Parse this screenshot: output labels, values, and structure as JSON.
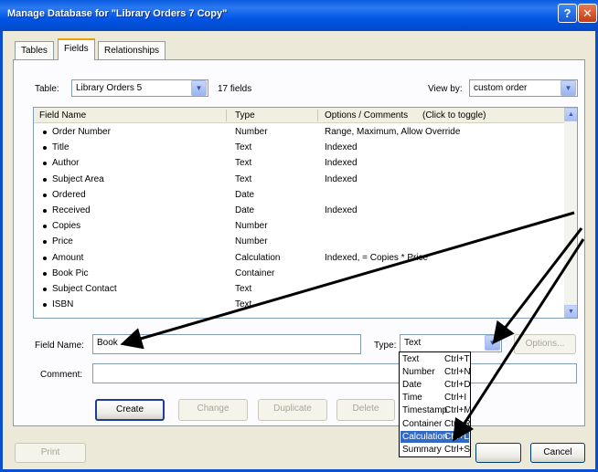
{
  "window": {
    "title": "Manage Database for \"Library Orders 7 Copy\""
  },
  "tabs": [
    {
      "label": "Tables"
    },
    {
      "label": "Fields"
    },
    {
      "label": "Relationships"
    }
  ],
  "toolbar": {
    "table_label": "Table:",
    "table_value": "Library Orders 5",
    "field_count": "17 fields",
    "view_by_label": "View by:",
    "view_by_value": "custom order"
  },
  "columns": [
    "Field Name",
    "Type",
    "Options / Comments",
    "(Click to toggle)"
  ],
  "fields": [
    {
      "name": "Order Number",
      "type": "Number",
      "options": "Range, Maximum, Allow Override"
    },
    {
      "name": "Title",
      "type": "Text",
      "options": "Indexed"
    },
    {
      "name": "Author",
      "type": "Text",
      "options": "Indexed"
    },
    {
      "name": "Subject Area",
      "type": "Text",
      "options": "Indexed"
    },
    {
      "name": "Ordered",
      "type": "Date",
      "options": ""
    },
    {
      "name": "Received",
      "type": "Date",
      "options": "Indexed"
    },
    {
      "name": "Copies",
      "type": "Number",
      "options": ""
    },
    {
      "name": "Price",
      "type": "Number",
      "options": ""
    },
    {
      "name": "Amount",
      "type": "Calculation",
      "options": "Indexed, = Copies * Price"
    },
    {
      "name": "Book Pic",
      "type": "Container",
      "options": ""
    },
    {
      "name": "Subject Contact",
      "type": "Text",
      "options": ""
    },
    {
      "name": "ISBN",
      "type": "Text",
      "options": ""
    }
  ],
  "form": {
    "field_name_label": "Field Name:",
    "field_name_value": "Book",
    "type_label": "Type:",
    "type_value": "Text",
    "options_label": "Options...",
    "comment_label": "Comment:",
    "comment_value": ""
  },
  "type_menu": [
    {
      "label": "Text",
      "shortcut": "Ctrl+T"
    },
    {
      "label": "Number",
      "shortcut": "Ctrl+N"
    },
    {
      "label": "Date",
      "shortcut": "Ctrl+D"
    },
    {
      "label": "Time",
      "shortcut": "Ctrl+I"
    },
    {
      "label": "Timestamp",
      "shortcut": "Ctrl+M"
    },
    {
      "label": "Container",
      "shortcut": "Ctrl+R"
    },
    {
      "label": "Calculation",
      "shortcut": "Ctrl+L"
    },
    {
      "label": "Summary",
      "shortcut": "Ctrl+S"
    }
  ],
  "buttons": {
    "create": "Create",
    "change": "Change",
    "duplicate": "Duplicate",
    "delete": "Delete",
    "print": "Print",
    "cancel": "Cancel"
  },
  "colors": {
    "title_bar": "#0055e5",
    "menu_highlight": "#316ac5",
    "frame": "#ece9d8"
  }
}
